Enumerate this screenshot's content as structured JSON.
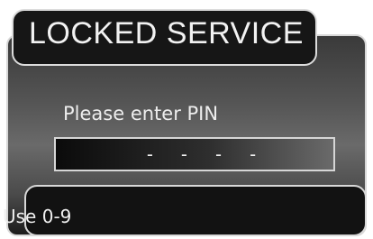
{
  "dialog": {
    "title": "LOCKED SERVICE",
    "prompt": "Please enter PIN",
    "pin_value": "- - - -",
    "hint": "Use 0-9"
  },
  "colors": {
    "panel_gradient_mid": "#6a6a6a",
    "panel_dark": "#161616",
    "border": "#d8d8d8",
    "text": "#f0f0f0"
  }
}
